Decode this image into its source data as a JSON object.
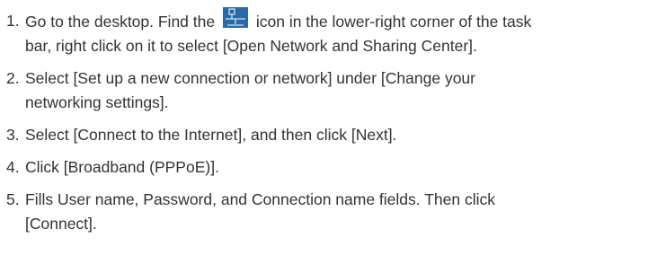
{
  "steps": [
    {
      "number": "1.",
      "text_before_icon": "Go to the desktop. Find the",
      "icon": "network-icon",
      "text_after_icon": "icon in the lower-right corner of the task",
      "line2": "bar, right click on it to select [Open Network and Sharing Center]."
    },
    {
      "number": "2.",
      "line1": "Select [Set up a new connection or network] under [Change your",
      "line2": "networking settings]."
    },
    {
      "number": "3.",
      "line1": "Select [Connect to the Internet], and then click [Next]."
    },
    {
      "number": "4.",
      "line1": "Click [Broadband (PPPoE)]."
    },
    {
      "number": "5.",
      "line1": "Fills User name, Password, and Connection name fields. Then click",
      "line2": "[Connect]."
    }
  ],
  "colors": {
    "text": "#333333",
    "icon_fill": "#2a6aa8",
    "icon_line": "#ffffff"
  }
}
